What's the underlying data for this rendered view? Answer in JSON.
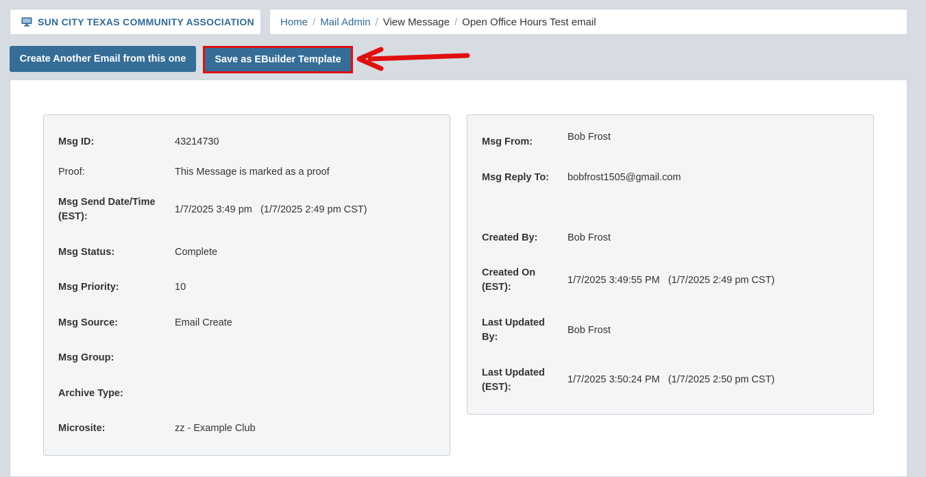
{
  "header": {
    "org_name": "SUN CITY TEXAS COMMUNITY ASSOCIATION",
    "org_icon": "monitor-icon"
  },
  "breadcrumb": {
    "home": "Home",
    "mail_admin": "Mail Admin",
    "view_message": "View Message",
    "current": "Open Office Hours Test email",
    "separator": "/"
  },
  "toolbar": {
    "create_another_label": "Create Another Email from this one",
    "save_template_label": "Save as EBuilder Template",
    "highlight_color": "#e01010"
  },
  "left_panel": {
    "msg_id_label": "Msg ID:",
    "msg_id": "43214730",
    "proof_label": "Proof:",
    "proof": "This Message is marked as a proof",
    "send_date_label_1": "Msg Send Date/Time",
    "send_date_label_2": "(EST):",
    "send_date": "1/7/2025 3:49 pm   (1/7/2025 2:49 pm CST)",
    "status_label": "Msg Status:",
    "status": "Complete",
    "priority_label": "Msg Priority:",
    "priority": "10",
    "source_label": "Msg Source:",
    "source": "Email Create",
    "group_label": "Msg Group:",
    "group": "",
    "archive_label": "Archive Type:",
    "archive": "",
    "microsite_label": "Microsite:",
    "microsite": "zz - Example Club"
  },
  "right_panel": {
    "from_label": "Msg From:",
    "from": "Bob Frost",
    "reply_label": "Msg Reply To:",
    "reply": "bobfrost1505@gmail.com",
    "created_by_label": "Created By:",
    "created_by": "Bob Frost",
    "created_on_label_1": "Created On",
    "created_on_label_2": "(EST):",
    "created_on": "1/7/2025 3:49:55 PM   (1/7/2025 2:49 pm CST)",
    "updated_by_label_1": "Last Updated",
    "updated_by_label_2": "By:",
    "updated_by": "Bob Frost",
    "updated_on_label_1": "Last Updated",
    "updated_on_label_2": "(EST):",
    "updated_on": "1/7/2025 3:50:24 PM   (1/7/2025 2:50 pm CST)"
  },
  "colors": {
    "brand": "#356d97",
    "link": "#2f6a96",
    "background": "#d6dce2"
  }
}
